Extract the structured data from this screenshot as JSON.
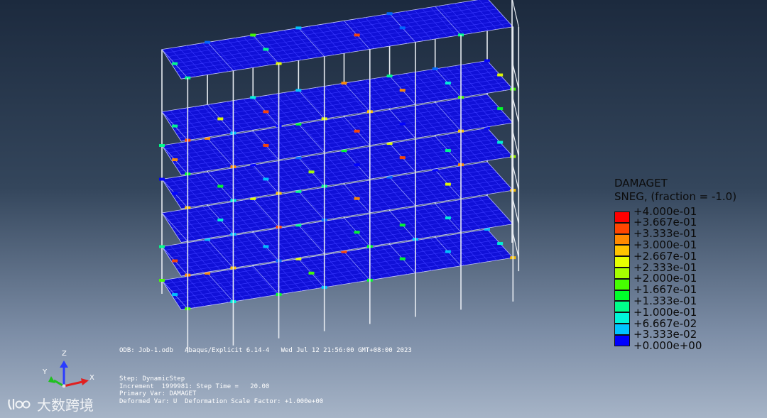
{
  "legend": {
    "title_line1": "DAMAGET",
    "title_line2": "SNEG, (fraction = -1.0)",
    "entries": [
      {
        "label": "+4.000e-01",
        "color": "#ff0000"
      },
      {
        "label": "+3.667e-01",
        "color": "#ff4600"
      },
      {
        "label": "+3.333e-01",
        "color": "#ff8a00"
      },
      {
        "label": "+3.000e-01",
        "color": "#ffc400"
      },
      {
        "label": "+2.667e-01",
        "color": "#e6ff00"
      },
      {
        "label": "+2.333e-01",
        "color": "#a6ff00"
      },
      {
        "label": "+2.000e-01",
        "color": "#46ff00"
      },
      {
        "label": "+1.667e-01",
        "color": "#00ff2a"
      },
      {
        "label": "+1.333e-01",
        "color": "#00ff8a"
      },
      {
        "label": "+1.000e-01",
        "color": "#00f5d8"
      },
      {
        "label": "+6.667e-02",
        "color": "#00c4ff"
      },
      {
        "label": "+3.333e-02",
        "color": "#0066ff"
      },
      {
        "label": "+0.000e+00",
        "color": "#0000ff"
      }
    ]
  },
  "info": {
    "odb_line": "ODB: Job-1.odb   Abaqus/Explicit 6.14-4   Wed Jul 12 21:56:00 GMT+08:00 2023",
    "step_line": "Step: DynamicStep",
    "increment_line": "Increment  1999981: Step Time =   20.00",
    "primary_var_line": "Primary Var: DAMAGET",
    "deformed_var_line": "Deformed Var: U  Deformation Scale Factor: +1.000e+00"
  },
  "triad": {
    "x_label": "X",
    "y_label": "Y",
    "z_label": "Z"
  },
  "watermark": {
    "logo_text": "!%)",
    "text": "大数跨境"
  },
  "model": {
    "slab_color": "#1010d8",
    "mesh_color": "#3a3aff",
    "frame_color": "#e8ecf2"
  }
}
